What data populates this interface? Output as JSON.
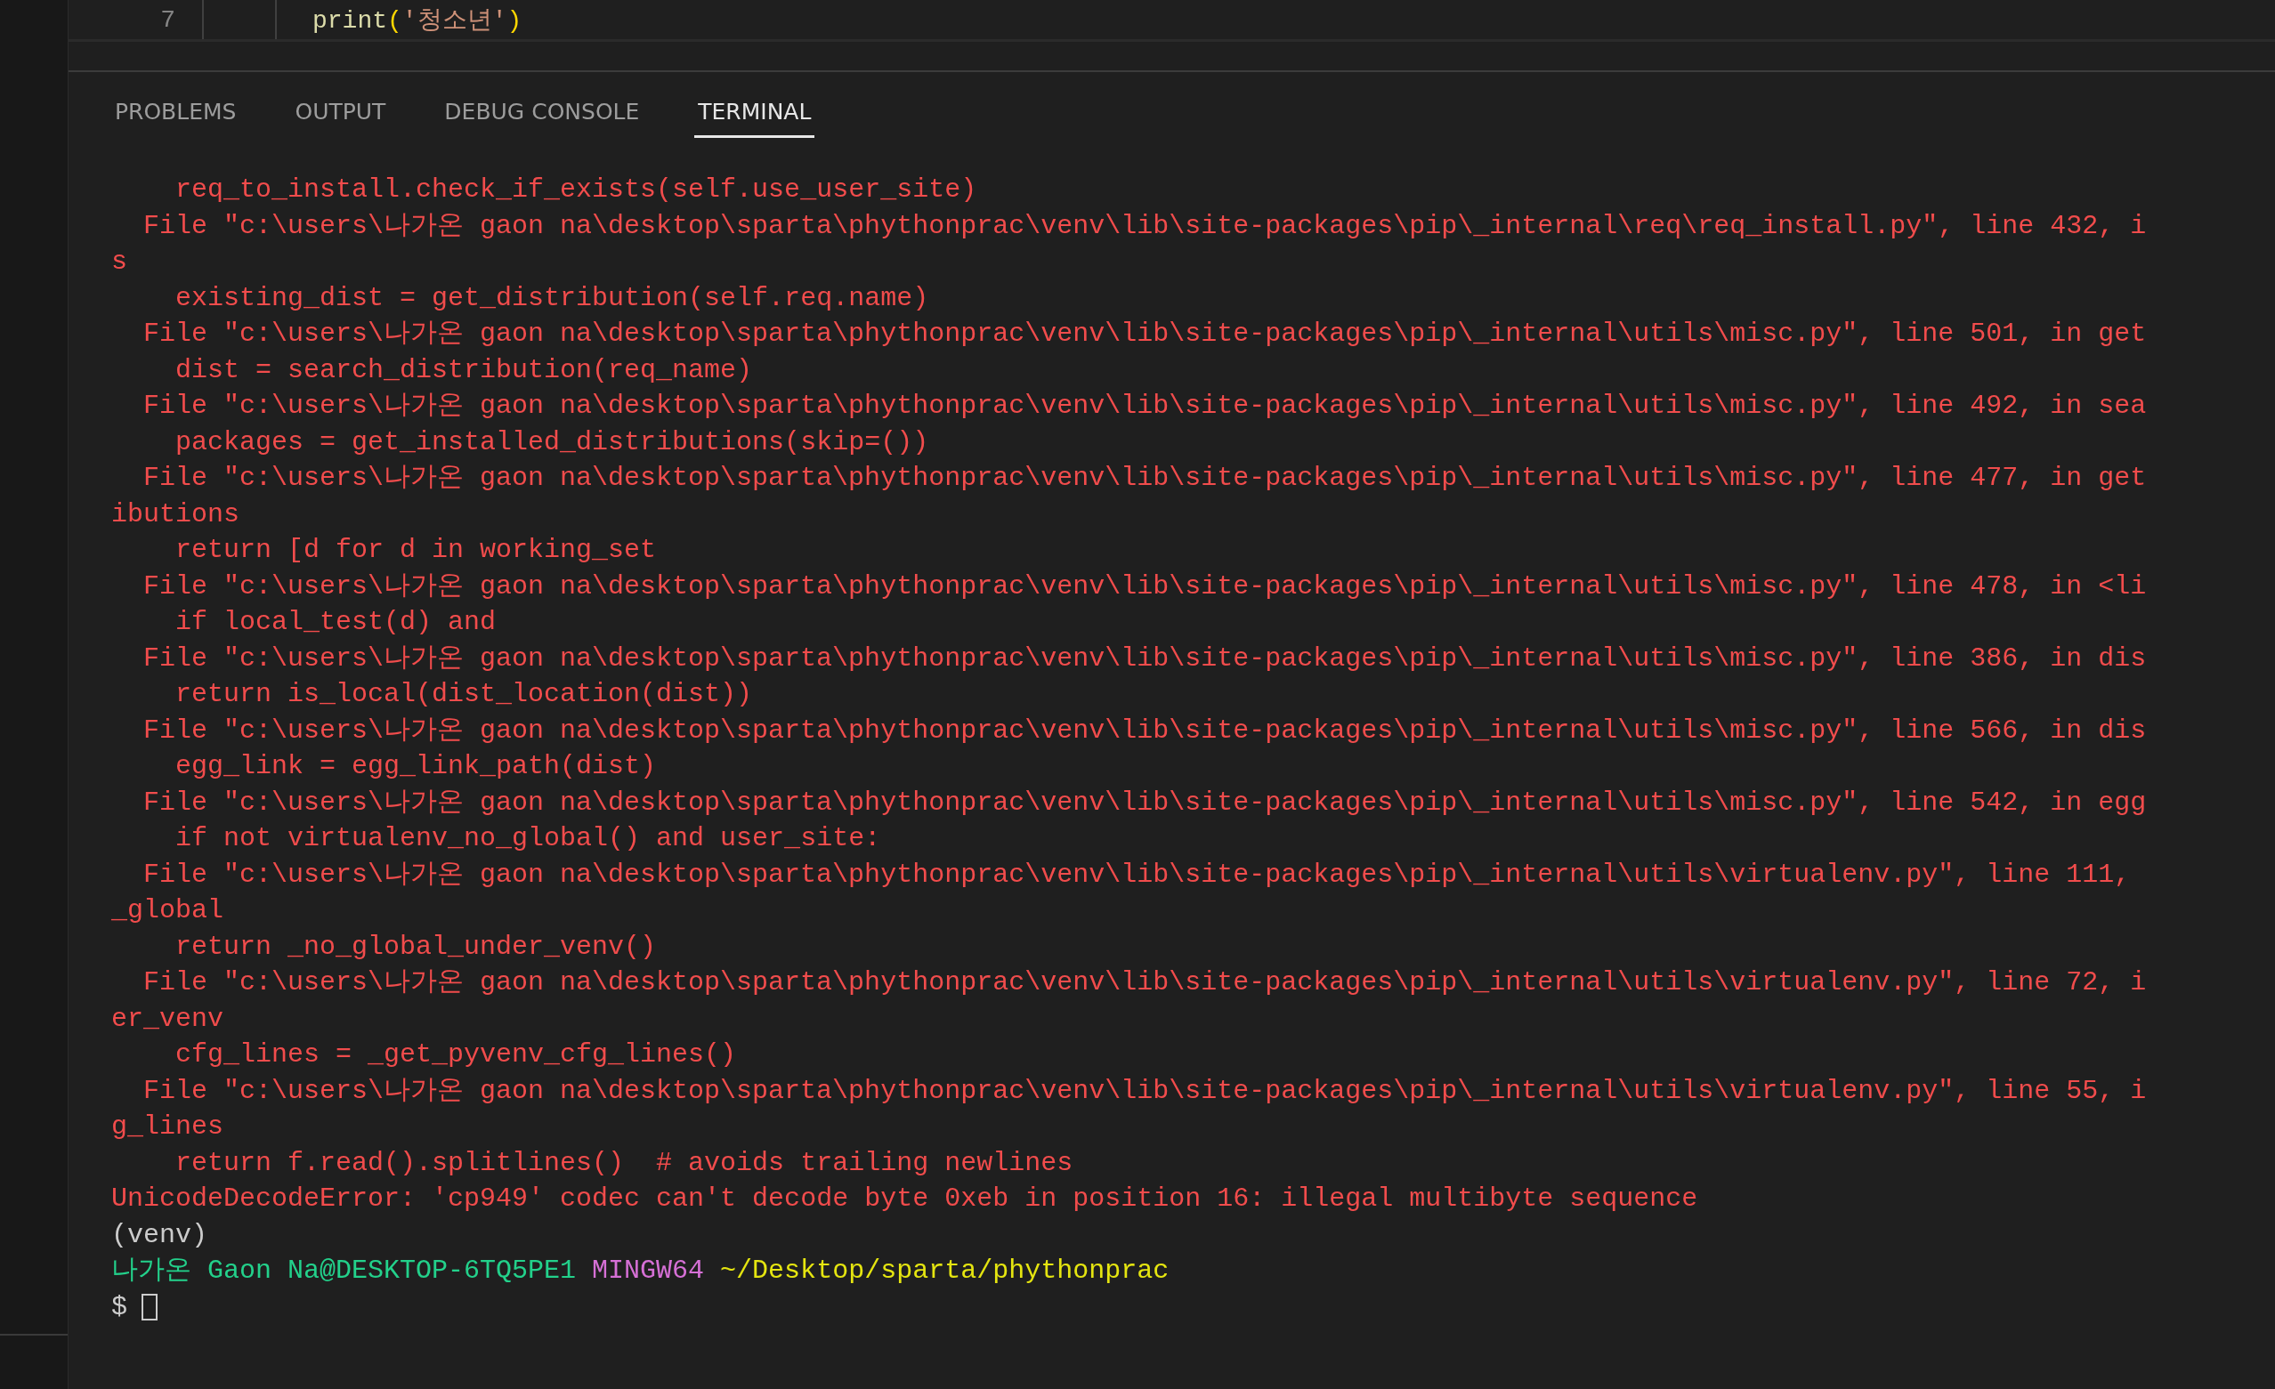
{
  "editor": {
    "line_number": "7",
    "code": [
      {
        "text": "print",
        "color": "#dcdcaa"
      },
      {
        "text": "(",
        "color": "#ffd700"
      },
      {
        "text": "'청소년'",
        "color": "#ce9178"
      },
      {
        "text": ")",
        "color": "#ffd700"
      }
    ]
  },
  "panel_tabs": [
    {
      "label": "PROBLEMS",
      "selected": false
    },
    {
      "label": "OUTPUT",
      "selected": false
    },
    {
      "label": "DEBUG CONSOLE",
      "selected": false
    },
    {
      "label": "TERMINAL",
      "selected": true
    }
  ],
  "terminal": [
    {
      "kind": "error",
      "text": "    req_to_install.check_if_exists(self.use_user_site)"
    },
    {
      "kind": "error",
      "text": "  File \"c:\\users\\나가온 gaon na\\desktop\\sparta\\phythonprac\\venv\\lib\\site-packages\\pip\\_internal\\req\\req_install.py\", line 432, i"
    },
    {
      "kind": "error",
      "text": "s"
    },
    {
      "kind": "error",
      "text": "    existing_dist = get_distribution(self.req.name)"
    },
    {
      "kind": "error",
      "text": "  File \"c:\\users\\나가온 gaon na\\desktop\\sparta\\phythonprac\\venv\\lib\\site-packages\\pip\\_internal\\utils\\misc.py\", line 501, in get"
    },
    {
      "kind": "error",
      "text": "    dist = search_distribution(req_name)"
    },
    {
      "kind": "error",
      "text": "  File \"c:\\users\\나가온 gaon na\\desktop\\sparta\\phythonprac\\venv\\lib\\site-packages\\pip\\_internal\\utils\\misc.py\", line 492, in sea"
    },
    {
      "kind": "error",
      "text": "    packages = get_installed_distributions(skip=())"
    },
    {
      "kind": "error",
      "text": "  File \"c:\\users\\나가온 gaon na\\desktop\\sparta\\phythonprac\\venv\\lib\\site-packages\\pip\\_internal\\utils\\misc.py\", line 477, in get"
    },
    {
      "kind": "error",
      "text": "ibutions"
    },
    {
      "kind": "error",
      "text": "    return [d for d in working_set"
    },
    {
      "kind": "error",
      "text": "  File \"c:\\users\\나가온 gaon na\\desktop\\sparta\\phythonprac\\venv\\lib\\site-packages\\pip\\_internal\\utils\\misc.py\", line 478, in <li"
    },
    {
      "kind": "error",
      "text": "    if local_test(d) and"
    },
    {
      "kind": "error",
      "text": "  File \"c:\\users\\나가온 gaon na\\desktop\\sparta\\phythonprac\\venv\\lib\\site-packages\\pip\\_internal\\utils\\misc.py\", line 386, in dis"
    },
    {
      "kind": "error",
      "text": "    return is_local(dist_location(dist))"
    },
    {
      "kind": "error",
      "text": "  File \"c:\\users\\나가온 gaon na\\desktop\\sparta\\phythonprac\\venv\\lib\\site-packages\\pip\\_internal\\utils\\misc.py\", line 566, in dis"
    },
    {
      "kind": "error",
      "text": "    egg_link = egg_link_path(dist)"
    },
    {
      "kind": "error",
      "text": "  File \"c:\\users\\나가온 gaon na\\desktop\\sparta\\phythonprac\\venv\\lib\\site-packages\\pip\\_internal\\utils\\misc.py\", line 542, in egg"
    },
    {
      "kind": "error",
      "text": "    if not virtualenv_no_global() and user_site:"
    },
    {
      "kind": "error",
      "text": "  File \"c:\\users\\나가온 gaon na\\desktop\\sparta\\phythonprac\\venv\\lib\\site-packages\\pip\\_internal\\utils\\virtualenv.py\", line 111,"
    },
    {
      "kind": "error",
      "text": "_global"
    },
    {
      "kind": "error",
      "text": "    return _no_global_under_venv()"
    },
    {
      "kind": "error",
      "text": "  File \"c:\\users\\나가온 gaon na\\desktop\\sparta\\phythonprac\\venv\\lib\\site-packages\\pip\\_internal\\utils\\virtualenv.py\", line 72, i"
    },
    {
      "kind": "error",
      "text": "er_venv"
    },
    {
      "kind": "error",
      "text": "    cfg_lines = _get_pyvenv_cfg_lines()"
    },
    {
      "kind": "error",
      "text": "  File \"c:\\users\\나가온 gaon na\\desktop\\sparta\\phythonprac\\venv\\lib\\site-packages\\pip\\_internal\\utils\\virtualenv.py\", line 55, i"
    },
    {
      "kind": "error",
      "text": "g_lines"
    },
    {
      "kind": "error",
      "text": "    return f.read().splitlines()  # avoids trailing newlines"
    },
    {
      "kind": "error",
      "text": "UnicodeDecodeError: 'cp949' codec can't decode byte 0xeb in position 16: illegal multibyte sequence"
    },
    {
      "kind": "plain",
      "text": "(venv)"
    },
    {
      "kind": "prompt",
      "segments": [
        {
          "text": "나가온 Gaon Na@DESKTOP-6TQ5PE1",
          "color": "#23d18b"
        },
        {
          "text": "MINGW64",
          "color": "#d670d6"
        },
        {
          "text": "~/Desktop/sparta/phythonprac",
          "color": "#e5e510"
        }
      ]
    },
    {
      "kind": "input",
      "text": "$"
    }
  ]
}
